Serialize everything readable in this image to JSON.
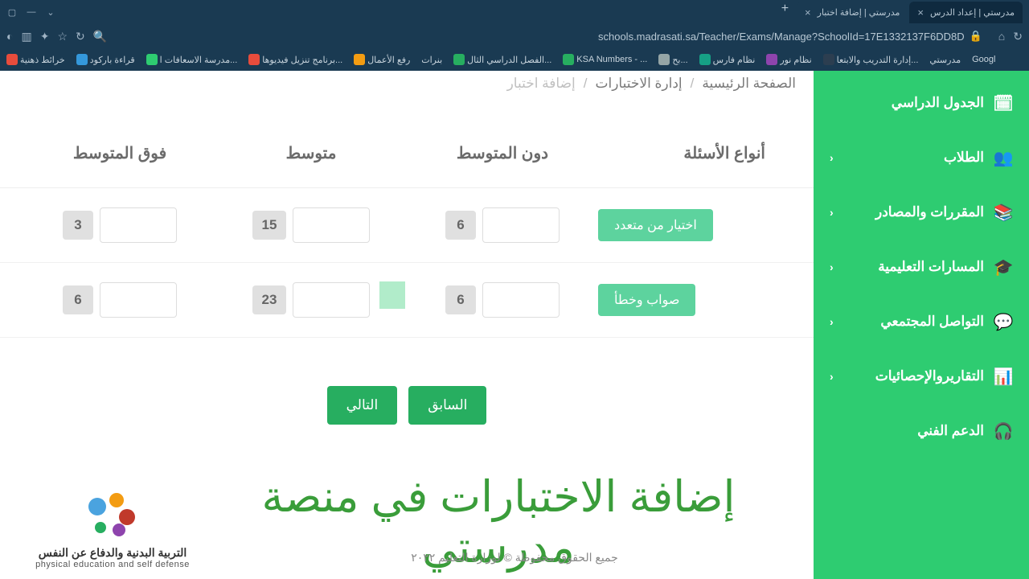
{
  "browser": {
    "tabs": [
      {
        "title": "مدرستي | إعداد الدرس"
      },
      {
        "title": "مدرستي | إضافة اختبار"
      }
    ],
    "url": "schools.madrasati.sa/Teacher/Exams/Manage?SchoolId=17E1332137F6DD8D",
    "bookmarks": [
      "خرائط ذهنية",
      "قراءة باركود",
      "مدرسة الاسعافات ا...",
      "برنامج تنزيل فيديوها...",
      "رفع الأعمال",
      "بنرات",
      "الفصل الدراسي الثال...",
      "KSA Numbers - ...",
      "بح...",
      "نظام فارس",
      "نظام نور",
      "إدارة التدريب والابتعا...",
      "مدرستي",
      "Googl"
    ]
  },
  "breadcrumb": {
    "home": "الصفحة الرئيسية",
    "manage": "إدارة الاختبارات",
    "current": "إضافة اختبار"
  },
  "sidebar": {
    "items": [
      {
        "label": "الجدول الدراسي",
        "icon": "calendar",
        "chev": false
      },
      {
        "label": "الطلاب",
        "icon": "students",
        "chev": true
      },
      {
        "label": "المقررات والمصادر",
        "icon": "books",
        "chev": true
      },
      {
        "label": "المسارات التعليمية",
        "icon": "path",
        "chev": true
      },
      {
        "label": "التواصل المجتمعي",
        "icon": "chat",
        "chev": true
      },
      {
        "label": "التقاريروالإحصائيات",
        "icon": "stats",
        "chev": true
      },
      {
        "label": "الدعم الفني",
        "icon": "support",
        "chev": false
      }
    ]
  },
  "table": {
    "headers": {
      "types": "أنواع الأسئلة",
      "below": "دون المتوسط",
      "avg": "متوسط",
      "above": "فوق المتوسط"
    },
    "rows": [
      {
        "type": "اختيار من متعدد",
        "below": "6",
        "avg": "15",
        "above": "3"
      },
      {
        "type": "صواب وخطأ",
        "below": "6",
        "avg": "23",
        "above": "6"
      }
    ]
  },
  "nav": {
    "prev": "السابق",
    "next": "التالي"
  },
  "footer": {
    "overlay_title": "إضافة الاختبارات في منصة مدرستي",
    "copyright": "جميع الحقوق محفوظة © لوزارة التعليم ٢٠٢٢",
    "logo_ar": "التربية البدنية والدفاع عن النفس",
    "logo_en": "physical education and self defense"
  }
}
